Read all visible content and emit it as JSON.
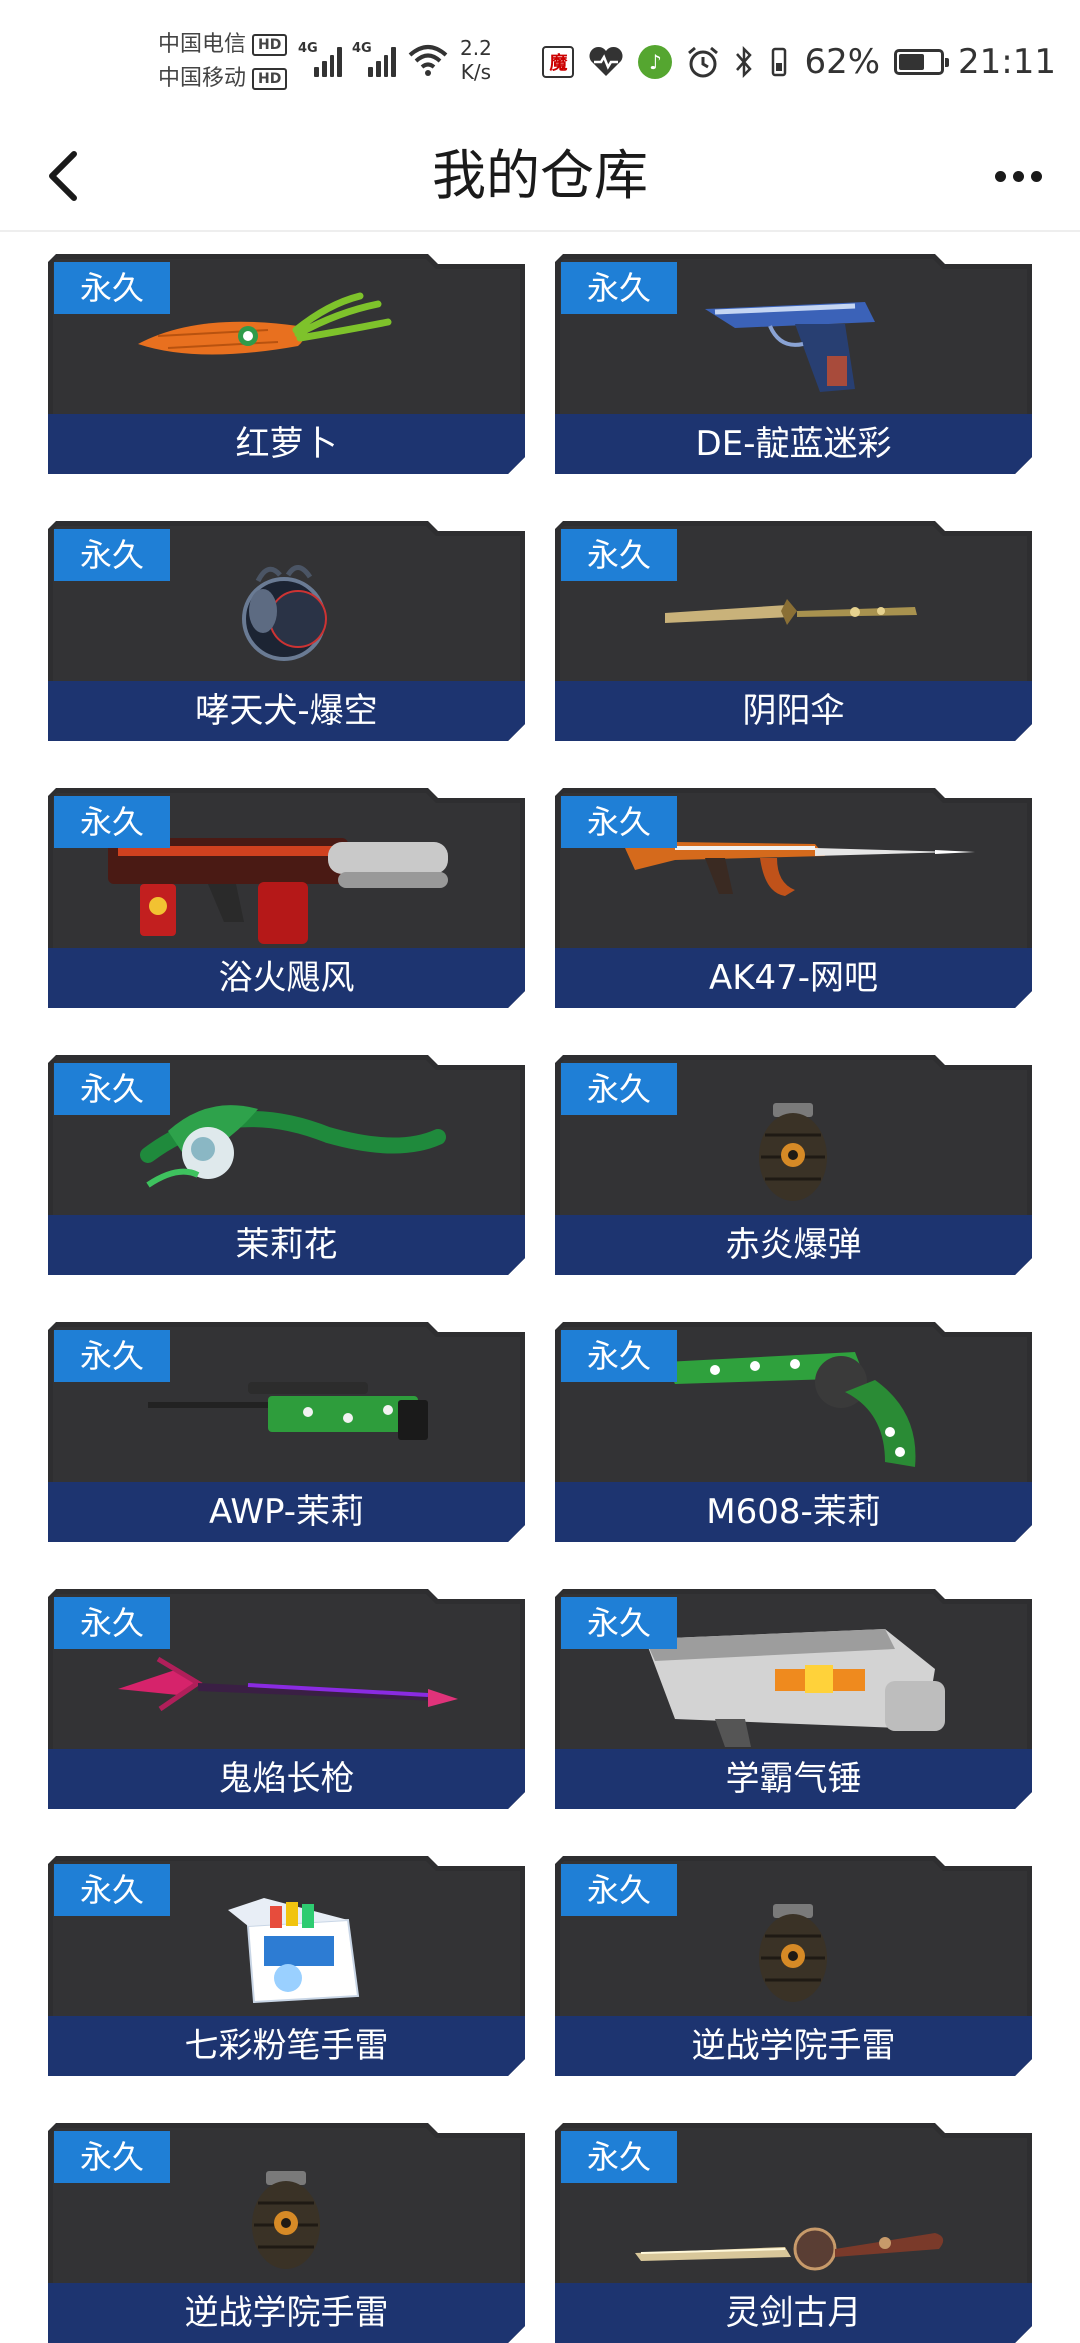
{
  "status_bar": {
    "carrier1": "中国电信",
    "carrier2": "中国移动",
    "hd": "HD",
    "net_type": "4G",
    "net_speed_value": "2.2",
    "net_speed_unit": "K/s",
    "battery_percent": "62%",
    "time": "21:11",
    "battery_level": 0.62
  },
  "header": {
    "title": "我的仓库"
  },
  "items": [
    {
      "badge": "永久",
      "name": "红萝卜",
      "icon": "carrot-icon"
    },
    {
      "badge": "永久",
      "name": "DE-靛蓝迷彩",
      "icon": "pistol-icon"
    },
    {
      "badge": "永久",
      "name": "哮天犬-爆空",
      "icon": "pet-orb-icon"
    },
    {
      "badge": "永久",
      "name": "阴阳伞",
      "icon": "staff-icon"
    },
    {
      "badge": "永久",
      "name": "浴火飓风",
      "icon": "heavy-gun-icon"
    },
    {
      "badge": "永久",
      "name": "AK47-网吧",
      "icon": "rifle-icon"
    },
    {
      "badge": "永久",
      "name": "茉莉花",
      "icon": "flower-weapon-icon"
    },
    {
      "badge": "永久",
      "name": "赤炎爆弹",
      "icon": "grenade-icon"
    },
    {
      "badge": "永久",
      "name": "AWP-茉莉",
      "icon": "sniper-icon"
    },
    {
      "badge": "永久",
      "name": "M608-茉莉",
      "icon": "revolver-icon"
    },
    {
      "badge": "永久",
      "name": "鬼焰长枪",
      "icon": "spear-icon"
    },
    {
      "badge": "永久",
      "name": "学霸气锤",
      "icon": "launcher-icon"
    },
    {
      "badge": "永久",
      "name": "七彩粉笔手雷",
      "icon": "chalk-box-icon"
    },
    {
      "badge": "永久",
      "name": "逆战学院手雷",
      "icon": "grenade-icon"
    },
    {
      "badge": "永久",
      "name": "逆战学院手雷",
      "icon": "grenade-icon"
    },
    {
      "badge": "永久",
      "name": "灵剑古月",
      "icon": "sword-icon"
    }
  ]
}
